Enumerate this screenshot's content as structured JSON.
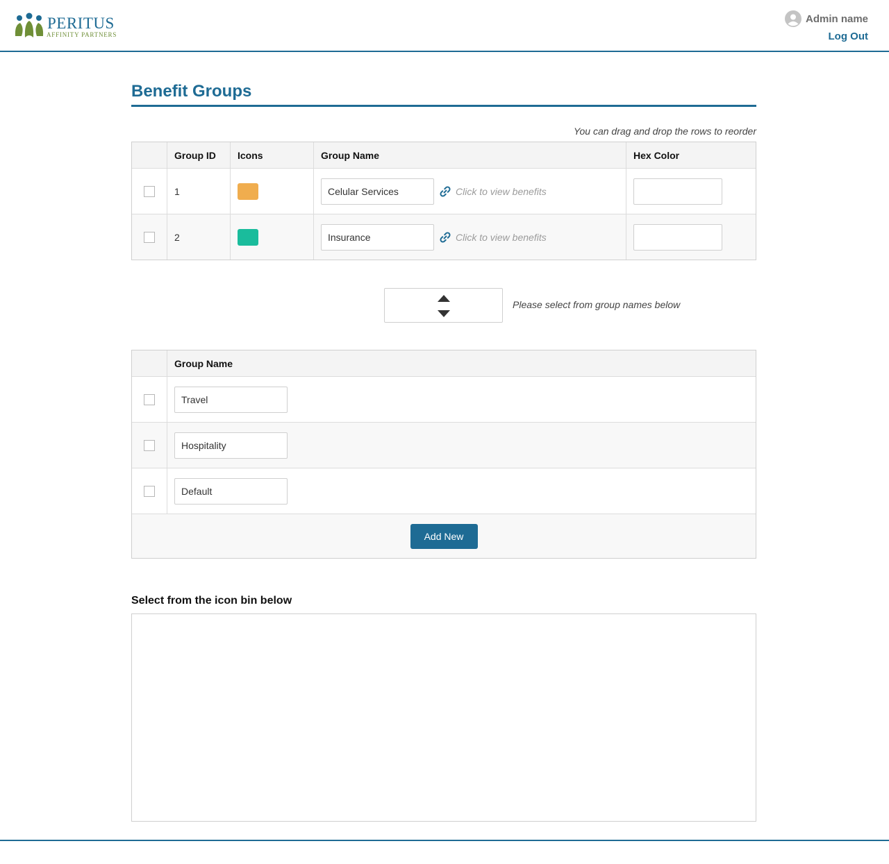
{
  "header": {
    "logo_word": "PERITUS",
    "logo_sub": "AFFINITY PARTNERS",
    "admin_name": "Admin name",
    "logout_label": "Log Out"
  },
  "page": {
    "title": "Benefit Groups",
    "drag_hint": "You can drag and drop the rows to reorder",
    "select_hint": "Please select from group names below",
    "icon_bin_title": "Select from the icon bin below"
  },
  "groups_table": {
    "headers": {
      "group_id": "Group ID",
      "icons": "Icons",
      "group_name": "Group Name",
      "hex_color": "Hex Color"
    },
    "rows": [
      {
        "id": "1",
        "icon_color": "#f0ad4e",
        "group_name": "Celular Services",
        "link_text": "Click to view benefits",
        "hex_color": ""
      },
      {
        "id": "2",
        "icon_color": "#1abc9c",
        "group_name": "Insurance",
        "link_text": "Click to view benefits",
        "hex_color": ""
      }
    ]
  },
  "names_table": {
    "header": "Group Name",
    "rows": [
      {
        "group_name": "Travel"
      },
      {
        "group_name": "Hospitality"
      },
      {
        "group_name": "Default"
      }
    ],
    "add_button": "Add New"
  },
  "colors": {
    "accent": "#1e6b94",
    "link": "#1e6b94"
  }
}
